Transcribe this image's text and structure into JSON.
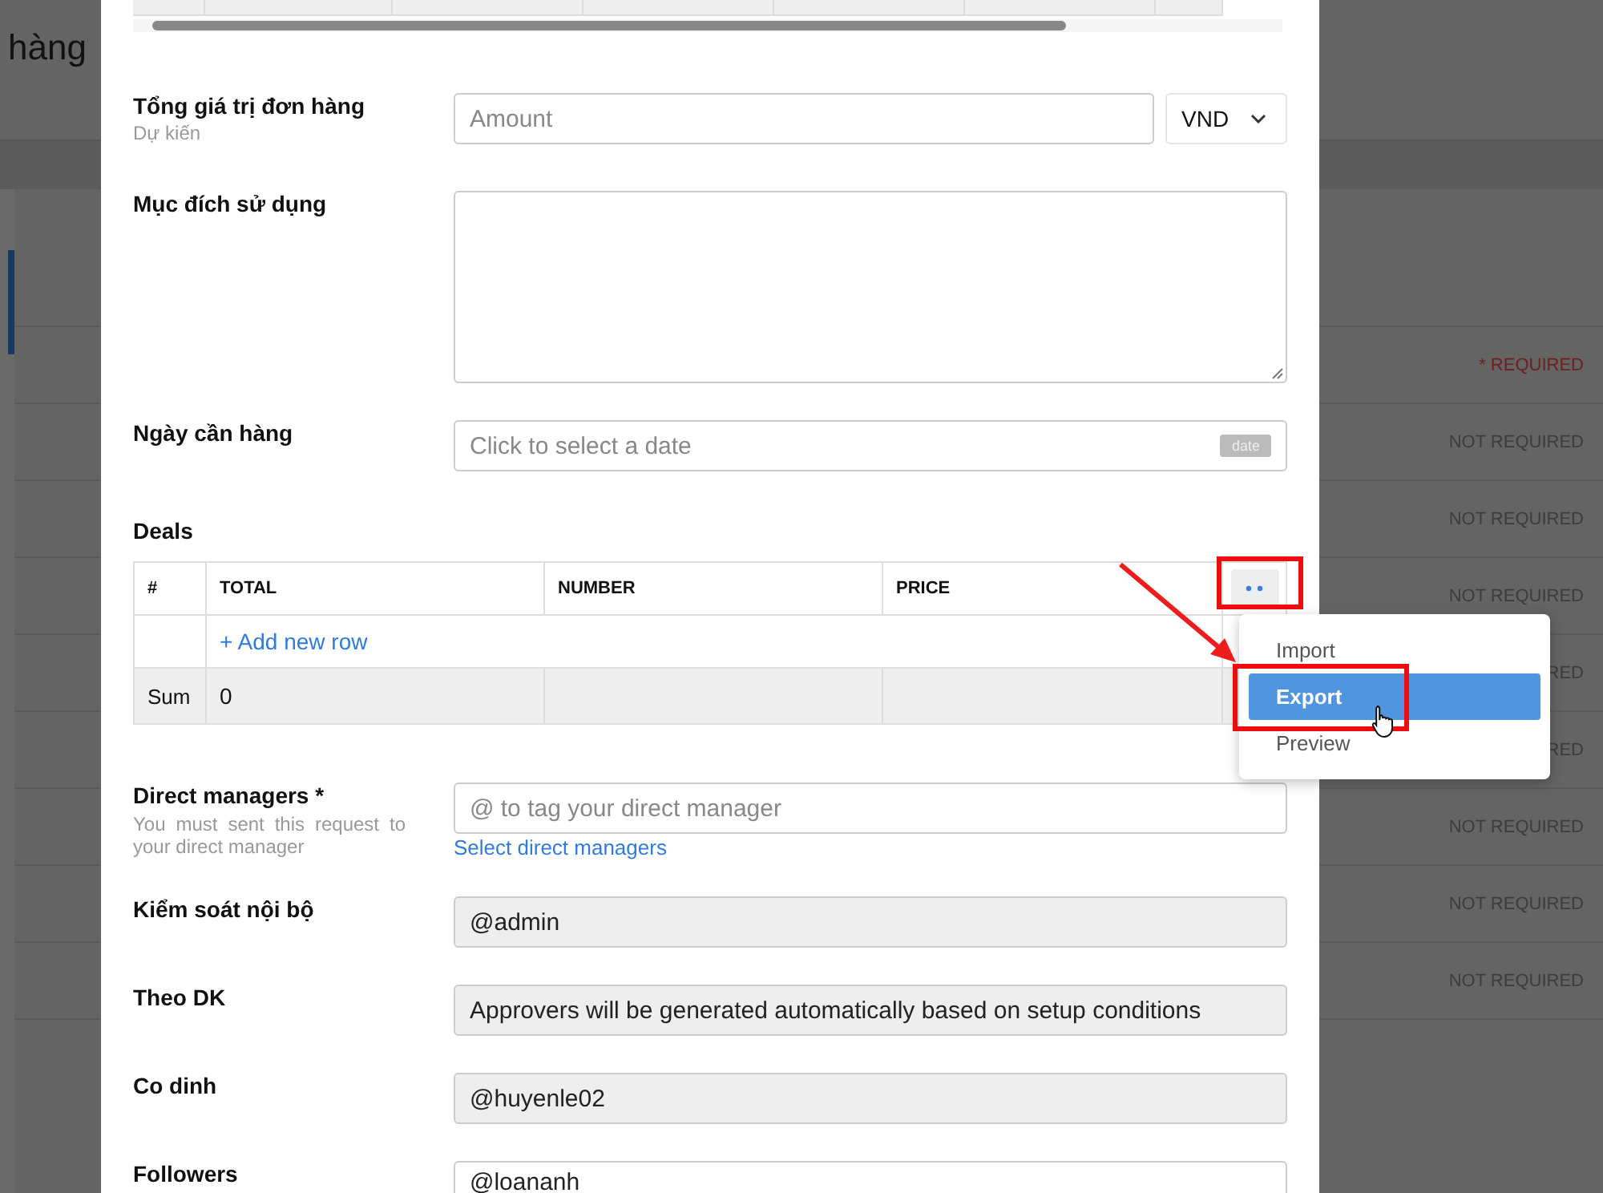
{
  "background": {
    "title": "hàng",
    "rows": [
      {
        "requirement": "* REQUIRED",
        "required": true
      },
      {
        "requirement": "NOT REQUIRED",
        "required": false
      },
      {
        "requirement": "NOT REQUIRED",
        "required": false
      },
      {
        "requirement": "NOT REQUIRED",
        "required": false
      },
      {
        "requirement": "RED",
        "required": false
      },
      {
        "requirement": "RED",
        "required": false
      },
      {
        "requirement": "NOT REQUIRED",
        "required": false
      },
      {
        "requirement": "NOT REQUIRED",
        "required": false
      },
      {
        "requirement": "NOT REQUIRED",
        "required": false
      }
    ]
  },
  "fields": [
    {
      "kind": "amount",
      "label": "Tổng giá trị đơn hàng",
      "hint": "Dự kiến",
      "placeholder": "Amount",
      "currency": "VND"
    },
    {
      "kind": "textarea",
      "label": "Mục đích sử dụng"
    },
    {
      "kind": "date",
      "label": "Ngày cần hàng",
      "placeholder": "Click to select a date",
      "badge": "date"
    }
  ],
  "deals": {
    "label": "Deals",
    "columns": [
      "#",
      "TOTAL",
      "NUMBER",
      "PRICE"
    ],
    "add_row": "+ Add new row",
    "sum_label": "Sum",
    "sum_total": "0"
  },
  "menu": {
    "items": [
      {
        "label": "Import",
        "selected": false
      },
      {
        "label": "Export",
        "selected": true
      },
      {
        "label": "Preview",
        "selected": false
      }
    ]
  },
  "approvers": [
    {
      "kind": "tag_input",
      "label": "Direct managers *",
      "hint": "You must sent this request to your direct manager",
      "placeholder": "@ to tag your direct manager",
      "link": "Select direct managers"
    },
    {
      "kind": "locked",
      "label": "Kiểm soát nội bộ",
      "value": "@admin"
    },
    {
      "kind": "locked",
      "label": "Theo DK",
      "value": "Approvers will be generated automatically based on setup conditions"
    },
    {
      "kind": "locked",
      "label": "Co dinh",
      "value": "@huyenle02"
    },
    {
      "kind": "open",
      "label": "Followers",
      "value": "@loananh"
    }
  ]
}
